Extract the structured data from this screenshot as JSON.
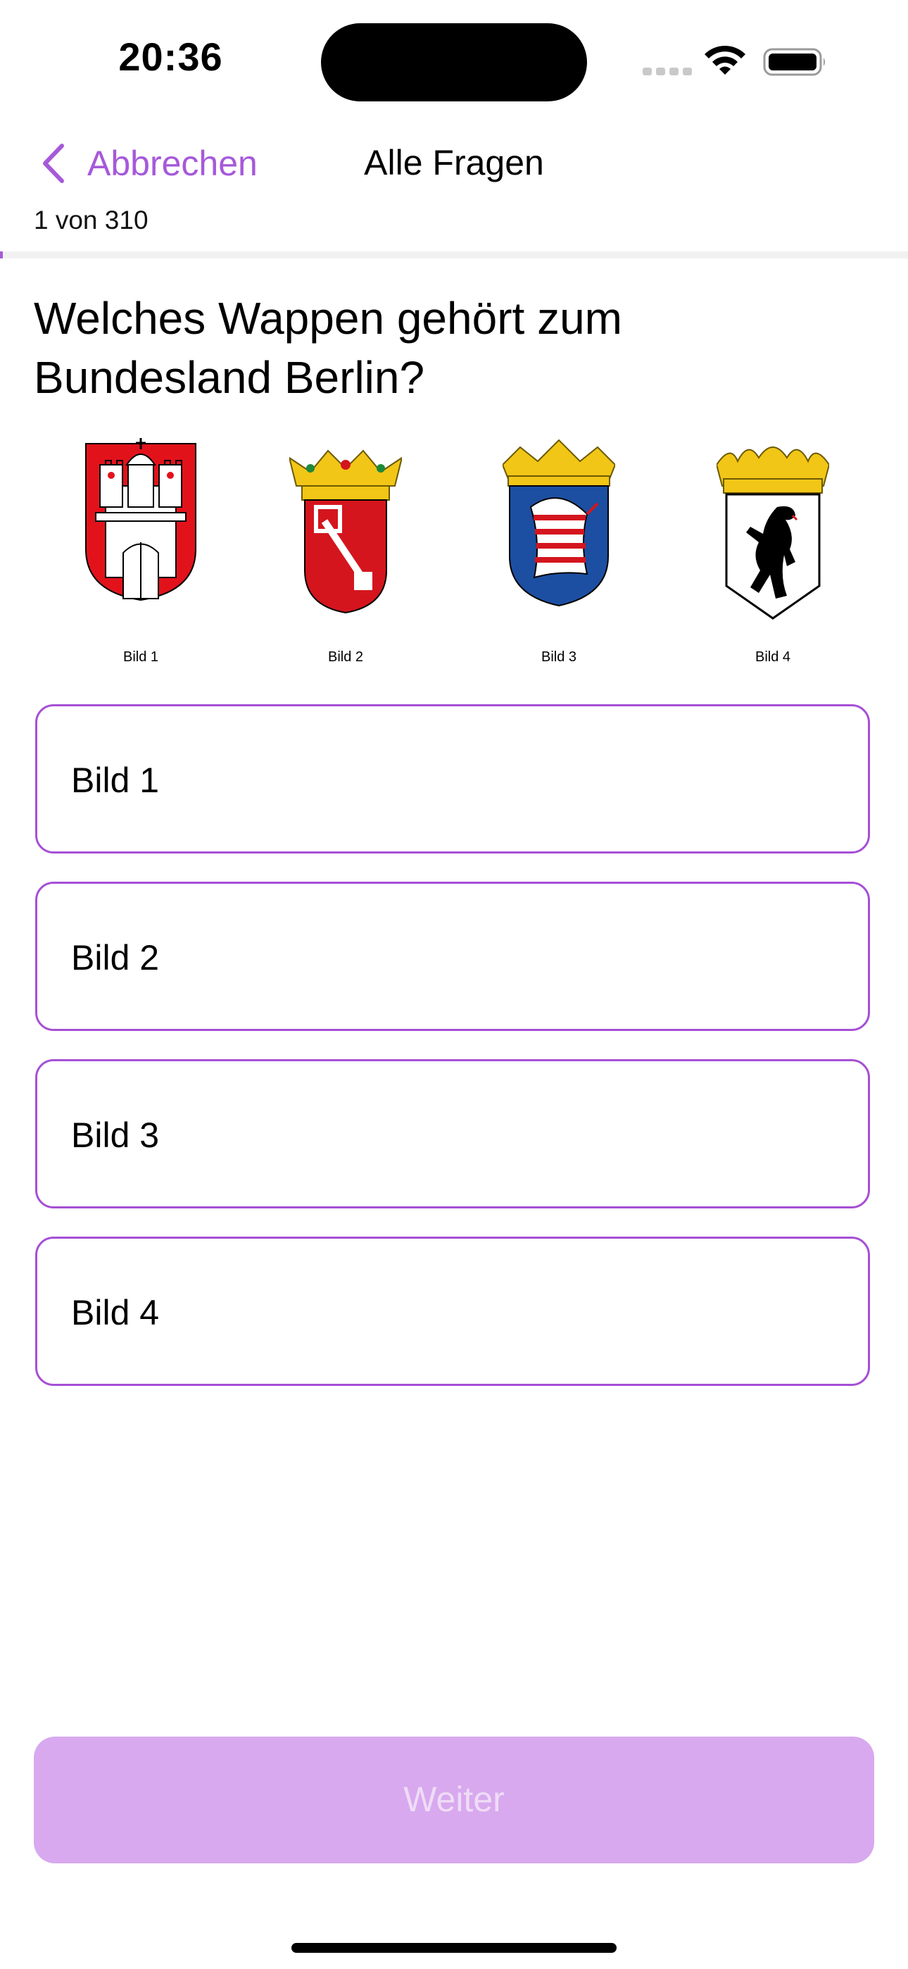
{
  "status_bar": {
    "time": "20:36",
    "icons": [
      "signal-icon",
      "wifi-icon",
      "battery-icon"
    ]
  },
  "nav": {
    "back_label": "Abbrechen",
    "title": "Alle Fragen"
  },
  "progress": {
    "text": "1 von 310",
    "current": 1,
    "total": 310
  },
  "question": {
    "text": "Welches Wappen gehört zum Bundesland Berlin?"
  },
  "images": [
    {
      "label": "Bild 1",
      "icon": "hamburg-coat-of-arms-icon"
    },
    {
      "label": "Bild 2",
      "icon": "bremen-coat-of-arms-icon"
    },
    {
      "label": "Bild 3",
      "icon": "hesse-coat-of-arms-icon"
    },
    {
      "label": "Bild 4",
      "icon": "berlin-coat-of-arms-icon"
    }
  ],
  "options": [
    {
      "label": "Bild 1"
    },
    {
      "label": "Bild 2"
    },
    {
      "label": "Bild 3"
    },
    {
      "label": "Bild 4"
    }
  ],
  "footer": {
    "next_label": "Weiter"
  },
  "colors": {
    "accent": "#a659d9",
    "option_border": "#a64fd6",
    "button_disabled_bg": "#d8a9ee",
    "button_disabled_text": "#efdcf7"
  }
}
